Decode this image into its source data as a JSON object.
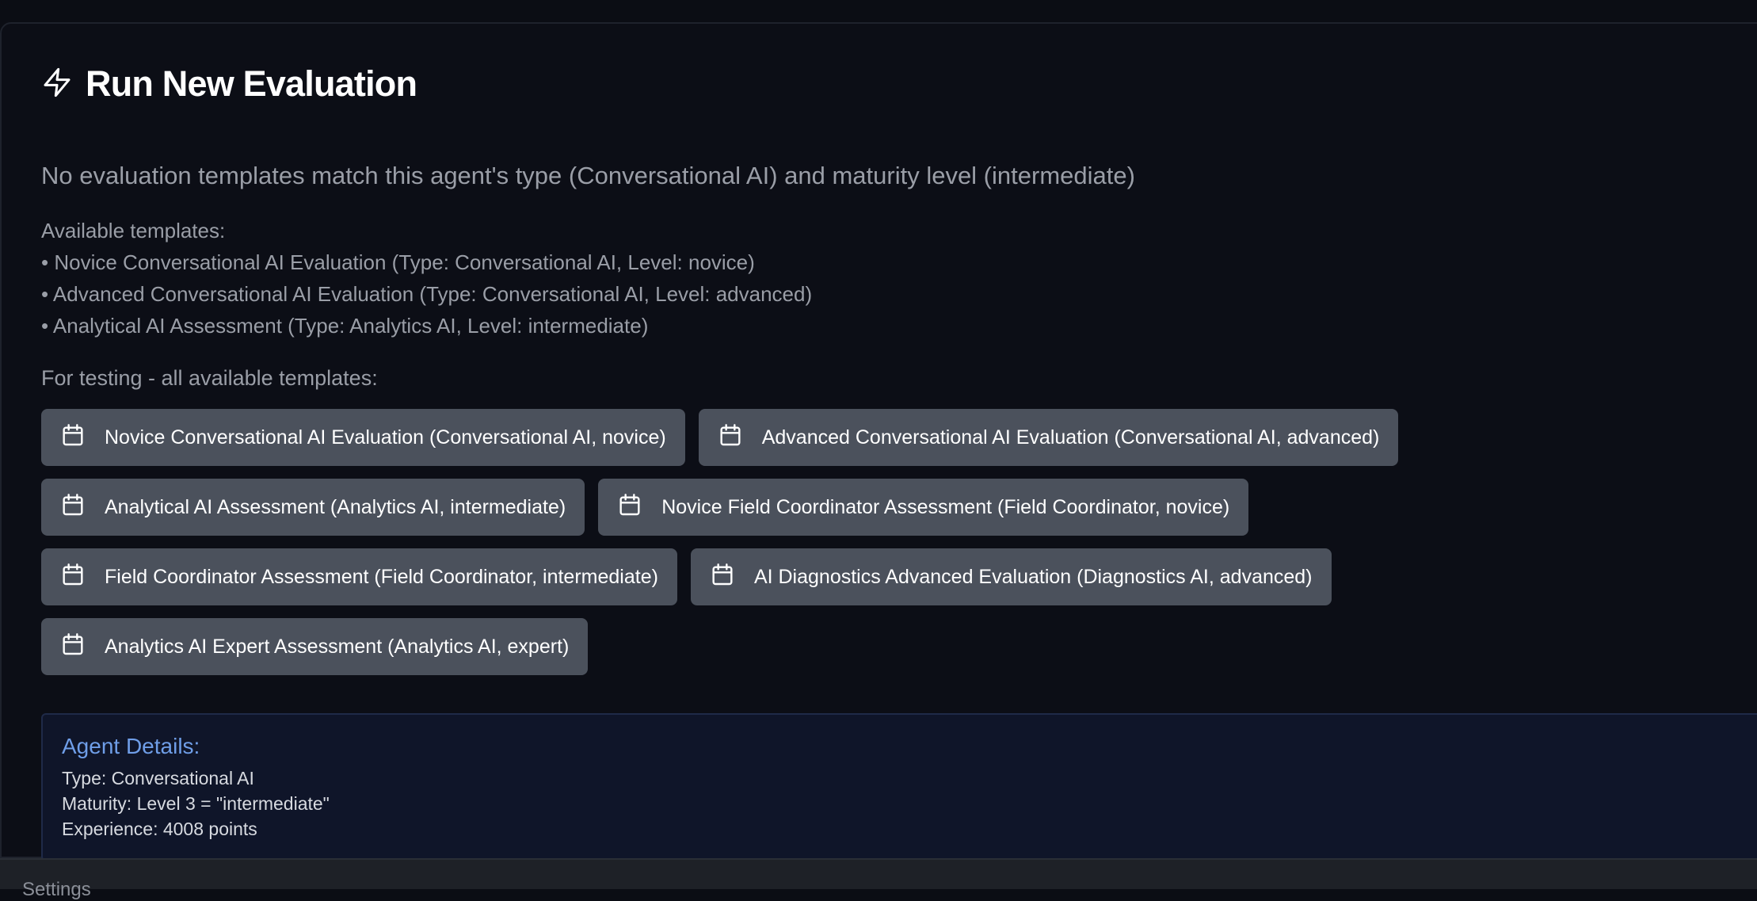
{
  "header": {
    "title": "Run New Evaluation",
    "icon": "lightning-icon"
  },
  "no_match_message": "No evaluation templates match this agent's type (Conversational AI) and maturity level (intermediate)",
  "available": {
    "heading": "Available templates:",
    "items": [
      "• Novice Conversational AI Evaluation (Type: Conversational AI, Level: novice)",
      "• Advanced Conversational AI Evaluation (Type: Conversational AI, Level: advanced)",
      "• Analytical AI Assessment (Type: Analytics AI, Level: intermediate)"
    ]
  },
  "testing": {
    "label": "For testing - all available templates:",
    "buttons": [
      "Novice Conversational AI Evaluation (Conversational AI, novice)",
      "Advanced Conversational AI Evaluation (Conversational AI, advanced)",
      "Analytical AI Assessment (Analytics AI, intermediate)",
      "Novice Field Coordinator Assessment (Field Coordinator, novice)",
      "Field Coordinator Assessment (Field Coordinator, intermediate)",
      "AI Diagnostics Advanced Evaluation (Diagnostics AI, advanced)",
      "Analytics AI Expert Assessment (Analytics AI, expert)"
    ],
    "button_icon": "calendar-icon"
  },
  "agent_details": {
    "title": "Agent Details:",
    "type": "Type: Conversational AI",
    "maturity": "Maturity: Level 3 = \"intermediate\"",
    "experience": "Experience: 4008 points"
  },
  "bottom_bar": {
    "label": "Settings"
  },
  "colors": {
    "background": "#0b0d14",
    "button_bg": "#4b515c",
    "details_bg": "#0f1529",
    "details_title": "#6f9ee8",
    "muted_text": "#9a9ea7"
  }
}
